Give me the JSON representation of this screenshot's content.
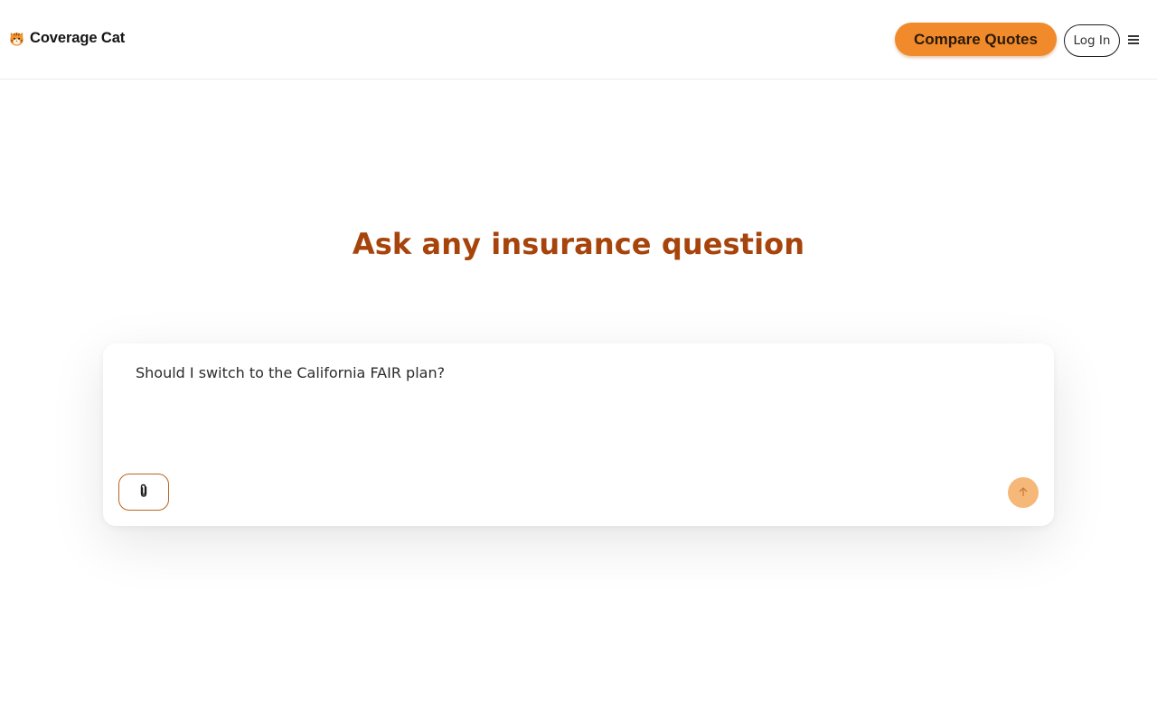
{
  "header": {
    "brand": "Coverage Cat",
    "logo_icon": "tiger-face-icon",
    "compare_label": "Compare Quotes",
    "login_label": "Log In",
    "menu_icon": "hamburger-menu-icon"
  },
  "main": {
    "headline": "Ask any insurance question",
    "chat": {
      "input_value": "Should I switch to the California FAIR plan?",
      "attach_icon": "paperclip-icon",
      "send_icon": "arrow-up-icon"
    }
  },
  "colors": {
    "accent": "#f08a2b",
    "headline": "#a6440c",
    "send_button": "#f5b878"
  }
}
